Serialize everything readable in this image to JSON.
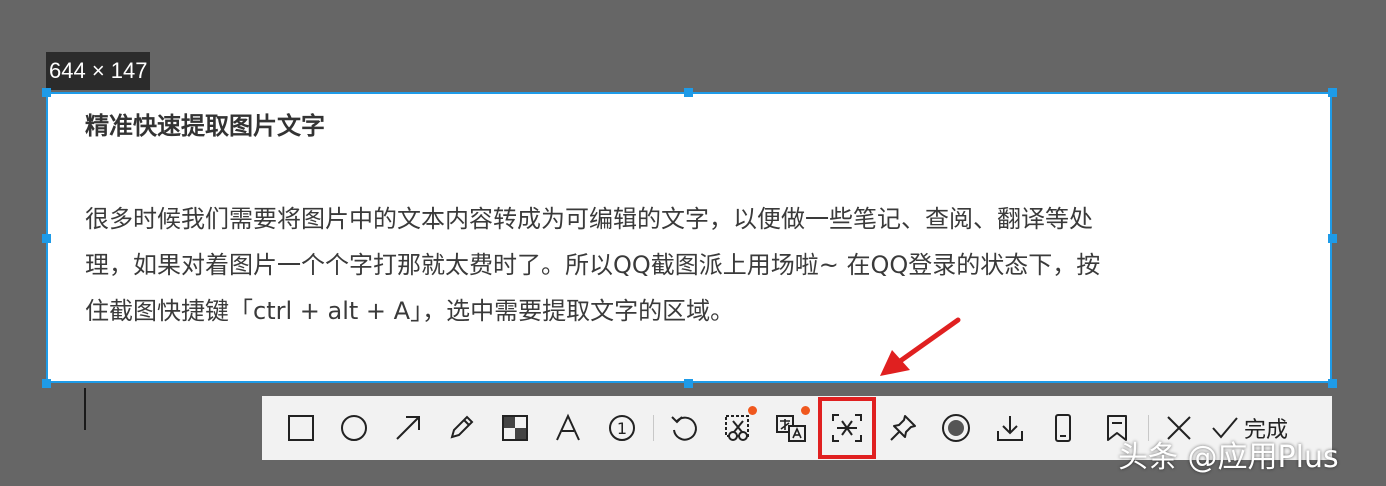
{
  "selection": {
    "size_label": "644 × 147",
    "accent_color": "#1e9be8"
  },
  "document": {
    "title": "精准快速提取图片文字",
    "lines": [
      "很多时候我们需要将图片中的文本内容转成为可编辑的文字，以便做一些笔记、查阅、翻译等处",
      "理，如果对着图片一个个字打那就太费时了。所以QQ截图派上用场啦~ 在QQ登录的状态下，按",
      "住截图快捷键「ctrl + alt + A」，选中需要提取文字的区域。"
    ]
  },
  "toolbar": {
    "tools": [
      {
        "icon": "rectangle-icon"
      },
      {
        "icon": "ellipse-icon"
      },
      {
        "icon": "arrow-icon"
      },
      {
        "icon": "pencil-icon"
      },
      {
        "icon": "mosaic-icon"
      },
      {
        "icon": "text-icon",
        "glyph": "A"
      },
      {
        "icon": "number-marker-icon",
        "glyph": "1"
      },
      {
        "icon": "undo-icon"
      },
      {
        "icon": "scissors-icon",
        "badge": true
      },
      {
        "icon": "translate-icon",
        "badge": true
      },
      {
        "icon": "extract-text-icon",
        "highlighted": true
      },
      {
        "icon": "pin-icon"
      },
      {
        "icon": "record-icon"
      },
      {
        "icon": "download-icon"
      },
      {
        "icon": "phone-icon"
      },
      {
        "icon": "bookmark-icon"
      },
      {
        "icon": "close-icon"
      }
    ],
    "done_label": "完成",
    "highlight_color": "#e02020",
    "badge_color": "#f0581e"
  },
  "watermark": "头条 @应用Plus"
}
